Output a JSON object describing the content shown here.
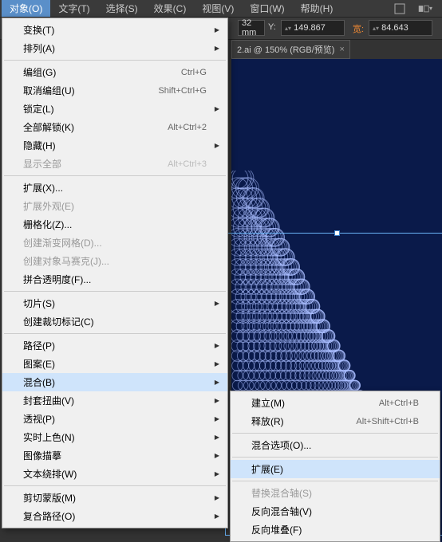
{
  "menubar": {
    "items": [
      "对象(O)",
      "文字(T)",
      "选择(S)",
      "效果(C)",
      "视图(V)",
      "窗口(W)",
      "帮助(H)"
    ],
    "activeIndex": 0
  },
  "toolbar": {
    "mm_value": "32 mm",
    "y_label": "Y:",
    "y_value": "149.867",
    "w_label": "宽:",
    "w_value": "84.643"
  },
  "tab": {
    "label": "2.ai @ 150% (RGB/预览)"
  },
  "mainMenu": [
    {
      "label": "变换(T)",
      "sub": true
    },
    {
      "label": "排列(A)",
      "sub": true
    },
    {
      "sep": true
    },
    {
      "label": "编组(G)",
      "shortcut": "Ctrl+G"
    },
    {
      "label": "取消编组(U)",
      "shortcut": "Shift+Ctrl+G"
    },
    {
      "label": "锁定(L)",
      "sub": true
    },
    {
      "label": "全部解锁(K)",
      "shortcut": "Alt+Ctrl+2"
    },
    {
      "label": "隐藏(H)",
      "sub": true
    },
    {
      "label": "显示全部",
      "shortcut": "Alt+Ctrl+3",
      "disabled": true
    },
    {
      "sep": true
    },
    {
      "label": "扩展(X)..."
    },
    {
      "label": "扩展外观(E)",
      "disabled": true
    },
    {
      "label": "栅格化(Z)..."
    },
    {
      "label": "创建渐变网格(D)...",
      "disabled": true
    },
    {
      "label": "创建对象马赛克(J)...",
      "disabled": true
    },
    {
      "label": "拼合透明度(F)..."
    },
    {
      "sep": true
    },
    {
      "label": "切片(S)",
      "sub": true
    },
    {
      "label": "创建裁切标记(C)"
    },
    {
      "sep": true
    },
    {
      "label": "路径(P)",
      "sub": true
    },
    {
      "label": "图案(E)",
      "sub": true
    },
    {
      "label": "混合(B)",
      "sub": true,
      "hover": true
    },
    {
      "label": "封套扭曲(V)",
      "sub": true
    },
    {
      "label": "透视(P)",
      "sub": true
    },
    {
      "label": "实时上色(N)",
      "sub": true
    },
    {
      "label": "图像描摹",
      "sub": true
    },
    {
      "label": "文本绕排(W)",
      "sub": true
    },
    {
      "sep": true
    },
    {
      "label": "剪切蒙版(M)",
      "sub": true
    },
    {
      "label": "复合路径(O)",
      "sub": true
    }
  ],
  "subMenu": [
    {
      "label": "建立(M)",
      "shortcut": "Alt+Ctrl+B"
    },
    {
      "label": "释放(R)",
      "shortcut": "Alt+Shift+Ctrl+B"
    },
    {
      "sep": true
    },
    {
      "label": "混合选项(O)..."
    },
    {
      "sep": true
    },
    {
      "label": "扩展(E)",
      "hover": true
    },
    {
      "sep": true
    },
    {
      "label": "替换混合轴(S)",
      "disabled": true
    },
    {
      "label": "反向混合轴(V)"
    },
    {
      "label": "反向堆叠(F)"
    }
  ]
}
